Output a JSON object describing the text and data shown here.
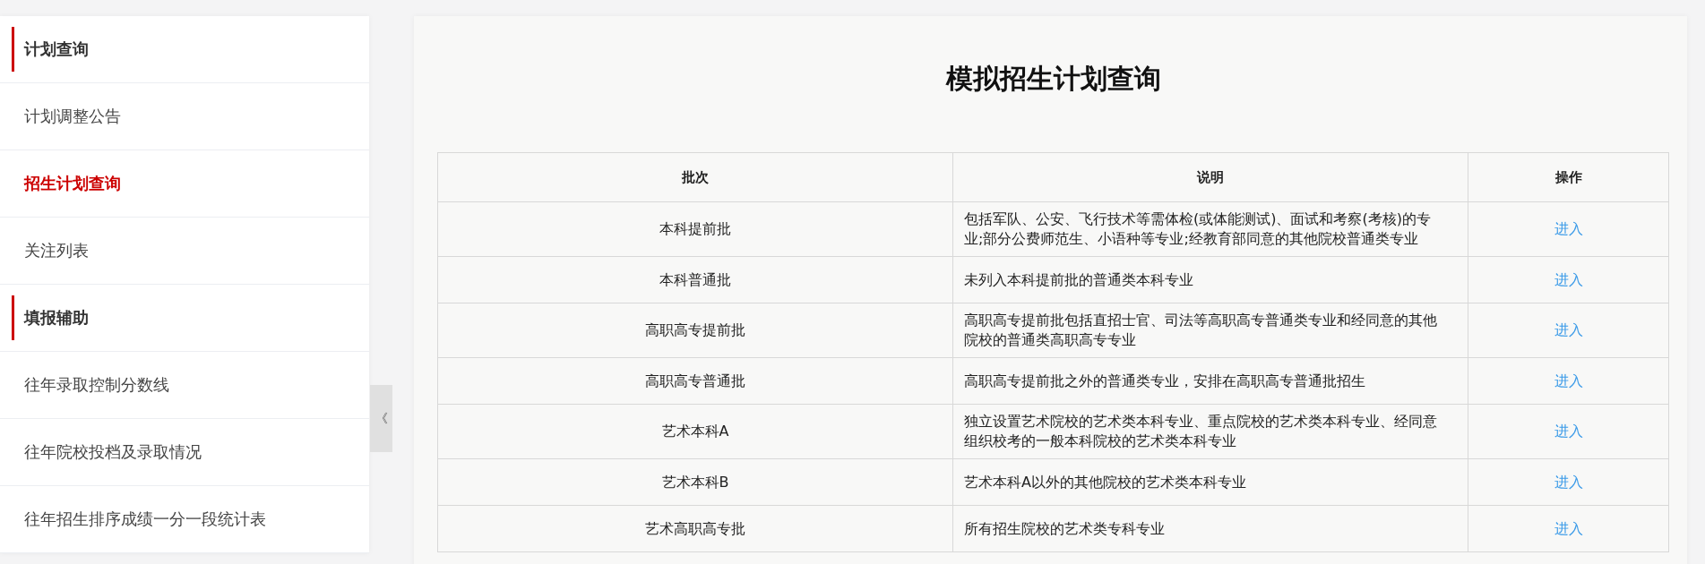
{
  "sidebar": {
    "items": [
      {
        "kind": "header",
        "label": "计划查询"
      },
      {
        "kind": "link",
        "label": "计划调整公告",
        "selected": false
      },
      {
        "kind": "link",
        "label": "招生计划查询",
        "selected": true
      },
      {
        "kind": "link",
        "label": "关注列表",
        "selected": false
      },
      {
        "kind": "header",
        "label": "填报辅助"
      },
      {
        "kind": "link",
        "label": "往年录取控制分数线",
        "selected": false
      },
      {
        "kind": "link",
        "label": "往年院校投档及录取情况",
        "selected": false
      },
      {
        "kind": "link",
        "label": "往年招生排序成绩一分一段统计表",
        "selected": false
      }
    ],
    "collapse_toggle": "《"
  },
  "main": {
    "title": "模拟招生计划查询",
    "table": {
      "columns": [
        "批次",
        "说明",
        "操作"
      ],
      "rows": [
        {
          "batch": "本科提前批",
          "description": "包括军队、公安、飞行技术等需体检(或体能测试)、面试和考察(考核)的专业;部分公费师范生、小语种等专业;经教育部同意的其他院校普通类专业",
          "action": "进入"
        },
        {
          "batch": "本科普通批",
          "description": "未列入本科提前批的普通类本科专业",
          "action": "进入"
        },
        {
          "batch": "高职高专提前批",
          "description": "高职高专提前批包括直招士官、司法等高职高专普通类专业和经同意的其他院校的普通类高职高专专业",
          "action": "进入"
        },
        {
          "batch": "高职高专普通批",
          "description": "高职高专提前批之外的普通类专业，安排在高职高专普通批招生",
          "action": "进入"
        },
        {
          "batch": "艺术本科A",
          "description": "独立设置艺术院校的艺术类本科专业、重点院校的艺术类本科专业、经同意组织校考的一般本科院校的艺术类本科专业",
          "action": "进入"
        },
        {
          "batch": "艺术本科B",
          "description": "艺术本科A以外的其他院校的艺术类本科专业",
          "action": "进入"
        },
        {
          "batch": "艺术高职高专批",
          "description": "所有招生院校的艺术类专科专业",
          "action": "进入"
        }
      ]
    }
  }
}
